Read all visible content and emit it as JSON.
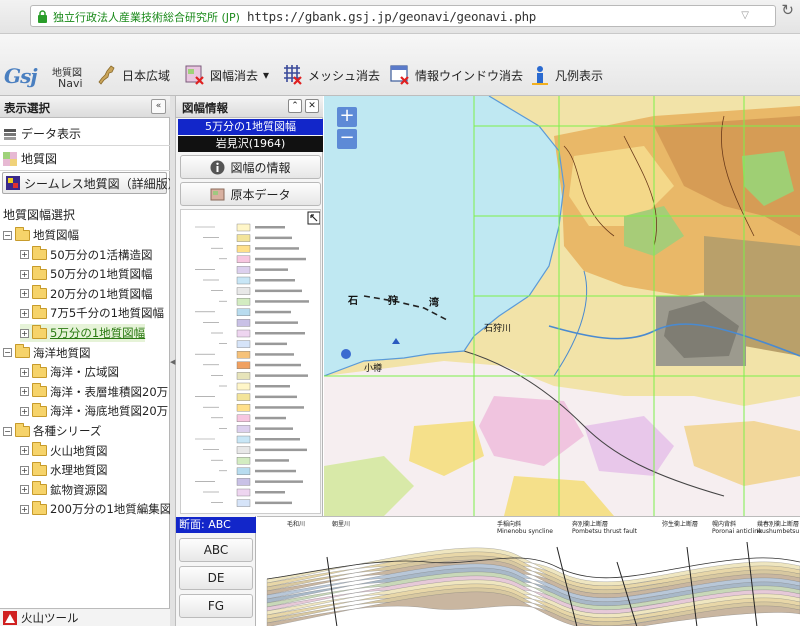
{
  "browser": {
    "cert_name": "独立行政法人産業技術総合研究所 (JP)",
    "url": "https://gbank.gsj.jp/geonavi/geonavi.php"
  },
  "toolbar": {
    "logo_gsj": "Gsj",
    "logo_title_1": "地質図",
    "logo_title_2": "Navi",
    "japan_wide": "日本広域",
    "sheet_clear": "図幅消去",
    "sheet_clear_arrow": "▾",
    "mesh_clear": "メッシュ消去",
    "info_window_clear": "情報ウインドウ消去",
    "legend_show": "凡例表示"
  },
  "sidebar": {
    "title": "表示選択",
    "collapse": "«",
    "data_display": "データ表示",
    "geology_map": "地質図",
    "seamless_select": "シームレス地質図（詳細版）",
    "tree_title": "地質図幅選択",
    "tree": [
      {
        "label": "地質図幅",
        "level": 0,
        "expander": "−"
      },
      {
        "label": "50万分の1活構造図",
        "level": 1,
        "expander": "+"
      },
      {
        "label": "50万分の1地質図幅",
        "level": 1,
        "expander": "+"
      },
      {
        "label": "20万分の1地質図幅",
        "level": 1,
        "expander": "+"
      },
      {
        "label": "7万5千分の1地質図幅",
        "level": 1,
        "expander": "+"
      },
      {
        "label": "5万分の1地質図幅",
        "level": 1,
        "expander": "+",
        "selected": true
      },
      {
        "label": "海洋地質図",
        "level": 0,
        "expander": "−"
      },
      {
        "label": "海洋・広域図",
        "level": 1,
        "expander": "+"
      },
      {
        "label": "海洋・表層堆積図20万",
        "level": 1,
        "expander": "+"
      },
      {
        "label": "海洋・海底地質図20万",
        "level": 1,
        "expander": "+"
      },
      {
        "label": "各種シリーズ",
        "level": 0,
        "expander": "−"
      },
      {
        "label": "火山地質図",
        "level": 1,
        "expander": "+"
      },
      {
        "label": "水理地質図",
        "level": 1,
        "expander": "+"
      },
      {
        "label": "鉱物資源図",
        "level": 1,
        "expander": "+"
      },
      {
        "label": "200万分の1地質編集図",
        "level": 1,
        "expander": "+"
      }
    ],
    "volcano_tools": "火山ツール"
  },
  "info_panel": {
    "title": "図幅情報",
    "sheet_type": "5万分の1地質図幅",
    "sheet_name": "岩見沢(1964)",
    "sheet_info_btn": "図幅の情報",
    "original_data_btn": "原本データ"
  },
  "map": {
    "zoom_in": "+",
    "zoom_out": "−",
    "place_labels": [
      "石",
      "狩",
      "湾",
      "石狩川",
      "小樽"
    ]
  },
  "section": {
    "label": "断面: ABC",
    "tabs": [
      "ABC",
      "DE",
      "FG"
    ],
    "labels": [
      {
        "text": "毛和川",
        "sub": ""
      },
      {
        "text": "朝里川",
        "sub": ""
      },
      {
        "text": "手稲向斜",
        "sub": "Minenobu syncline"
      },
      {
        "text": "奔別衝上断層",
        "sub": "Pombetsu thrust fault"
      },
      {
        "text": "弥生衝上断層",
        "sub": ""
      },
      {
        "text": "幌内背斜",
        "sub": "Poronai anticline"
      },
      {
        "text": "幾春別衝上断層",
        "sub": "Ikushumbetsu thrust"
      }
    ]
  },
  "colors": {
    "accent_blue": "#1226c9",
    "zoom_blue": "#5d8ad6",
    "sea": "#bfe8f2",
    "grid_green": "#7cf04a"
  }
}
